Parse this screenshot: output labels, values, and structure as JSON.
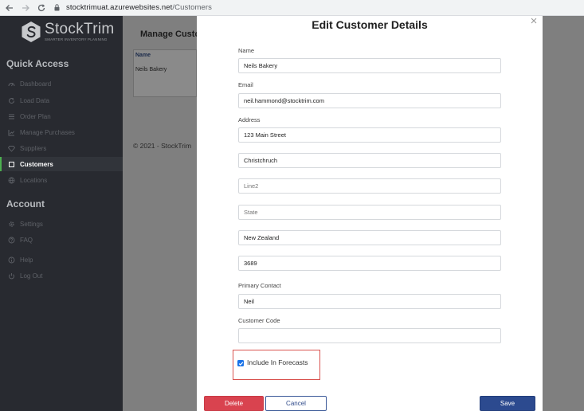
{
  "browser": {
    "domain": "stocktrimuat.azurewebsites.net",
    "path": "/Customers"
  },
  "sidebar": {
    "logo_name": "StockTrim",
    "logo_tagline": "SMARTER INVENTORY PLANNING",
    "quick_access_title": "Quick Access",
    "account_title": "Account",
    "quick_items": [
      {
        "label": "Dashboard",
        "icon": "dashboard-icon"
      },
      {
        "label": "Load Data",
        "icon": "refresh-icon"
      },
      {
        "label": "Order Plan",
        "icon": "list-icon"
      },
      {
        "label": "Manage Purchases",
        "icon": "chart-icon"
      },
      {
        "label": "Suppliers",
        "icon": "diamond-icon"
      },
      {
        "label": "Customers",
        "icon": "square-icon",
        "active": true
      },
      {
        "label": "Locations",
        "icon": "globe-icon"
      }
    ],
    "account_items": [
      {
        "label": "Settings",
        "icon": "gear-icon"
      },
      {
        "label": "FAQ",
        "icon": "question-icon"
      },
      {
        "label": "Help",
        "icon": "info-icon"
      },
      {
        "label": "Log Out",
        "icon": "power-icon"
      }
    ]
  },
  "background": {
    "title": "Manage Custo",
    "table_header": "Name",
    "table_row": "Neils Bakery",
    "footer": "© 2021 - StockTrim"
  },
  "modal": {
    "title": "Edit Customer Details",
    "close": "×",
    "name_label": "Name",
    "name_value": "Neils Bakery",
    "email_label": "Email",
    "email_value": "neil.hammond@stocktrim.com",
    "address_label": "Address",
    "address_line1": "123 Main Street",
    "address_city": "Christchruch",
    "address_line2_placeholder": "Line2",
    "address_state_placeholder": "State",
    "address_country": "New Zealand",
    "address_postcode": "3689",
    "contact_label": "Primary Contact",
    "contact_value": "Neil",
    "code_label": "Customer Code",
    "code_value": "",
    "include_forecasts_label": "Include In Forecasts",
    "include_forecasts_checked": true,
    "delete_label": "Delete",
    "cancel_label": "Cancel",
    "save_label": "Save"
  },
  "colors": {
    "sidebar_bg": "#282a30",
    "active_accent": "#4caf50",
    "delete": "#d9434f",
    "save": "#2c4a8f",
    "highlight_box": "#d9534f"
  }
}
